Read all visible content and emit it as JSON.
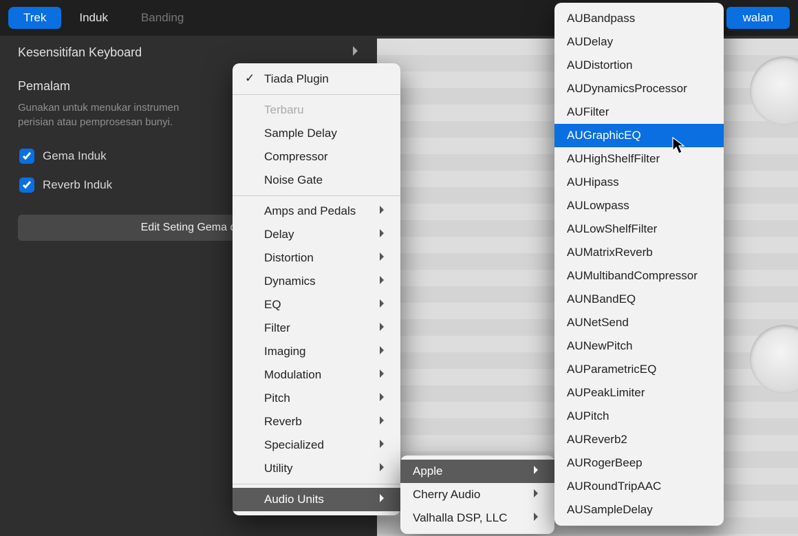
{
  "topbar": {
    "tabs": {
      "trek": "Trek",
      "induk": "Induk",
      "banding": "Banding"
    },
    "kawalan": "walan"
  },
  "sidebar": {
    "kesensitifan": "Kesensitifan Keyboard",
    "pemalam_title": "Pemalam",
    "pemalam_help": "Gunakan untuk menukar instrumen perisian atau pemprosesan bunyi.",
    "gema_label": "Gema Induk",
    "reverb_label": "Reverb Induk",
    "edit_label": "Edit Seting Gema d"
  },
  "menu1": {
    "tiada": "Tiada Plugin",
    "terbaru": "Terbaru",
    "recent": [
      "Sample Delay",
      "Compressor",
      "Noise Gate"
    ],
    "categories": [
      "Amps and Pedals",
      "Delay",
      "Distortion",
      "Dynamics",
      "EQ",
      "Filter",
      "Imaging",
      "Modulation",
      "Pitch",
      "Reverb",
      "Specialized",
      "Utility"
    ],
    "audiounits": "Audio Units"
  },
  "menu2": {
    "items": [
      "Apple",
      "Cherry Audio",
      "Valhalla DSP, LLC"
    ]
  },
  "menu3": {
    "items": [
      "AUBandpass",
      "AUDelay",
      "AUDistortion",
      "AUDynamicsProcessor",
      "AUFilter",
      "AUGraphicEQ",
      "AUHighShelfFilter",
      "AUHipass",
      "AULowpass",
      "AULowShelfFilter",
      "AUMatrixReverb",
      "AUMultibandCompressor",
      "AUNBandEQ",
      "AUNetSend",
      "AUNewPitch",
      "AUParametricEQ",
      "AUPeakLimiter",
      "AUPitch",
      "AUReverb2",
      "AURogerBeep",
      "AURoundTripAAC",
      "AUSampleDelay"
    ],
    "selected_index": 5
  }
}
